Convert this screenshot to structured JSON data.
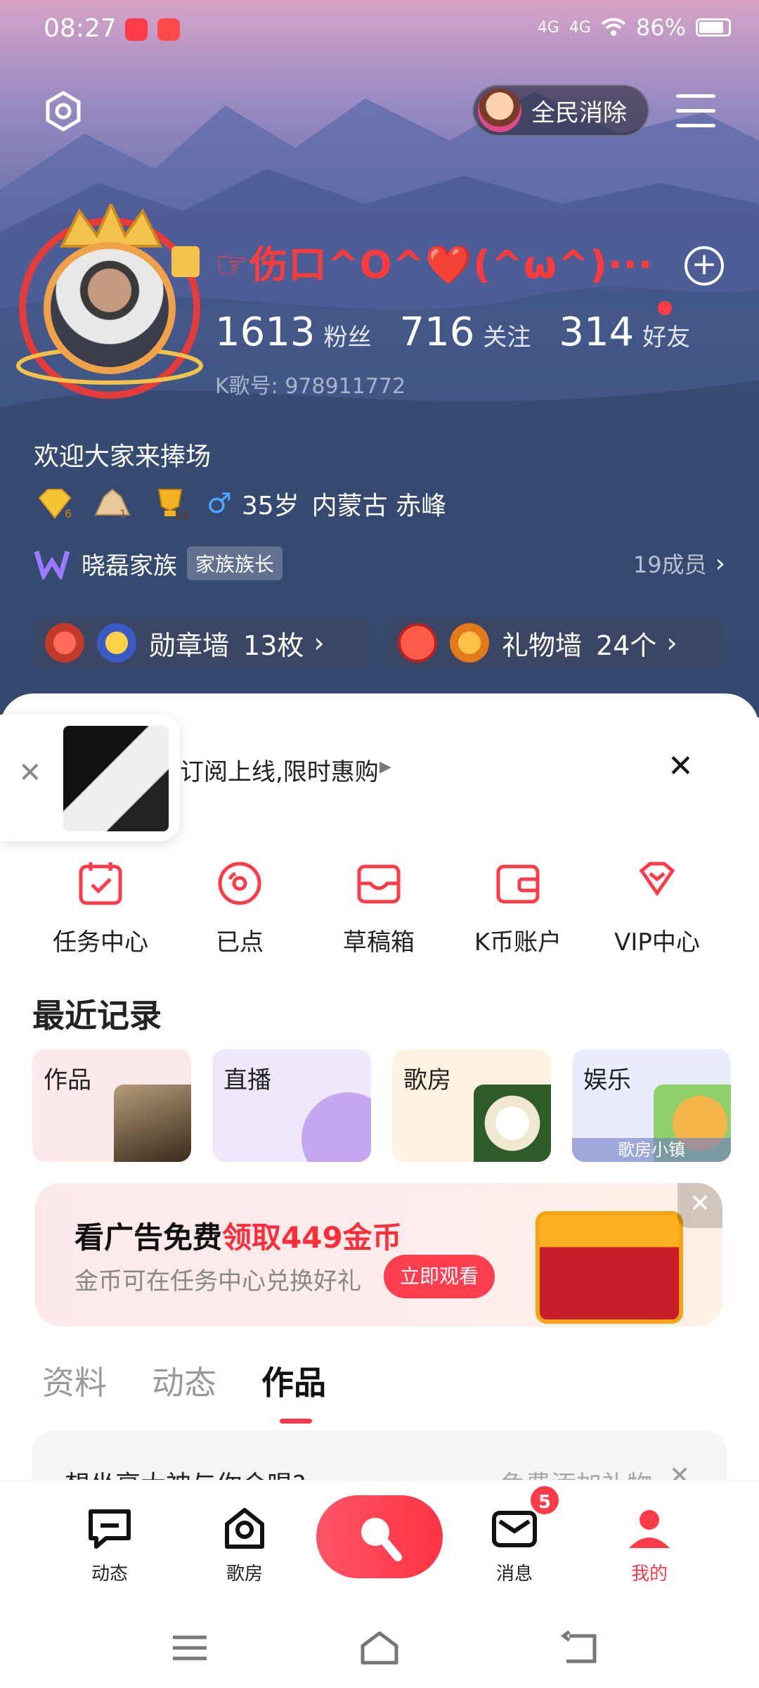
{
  "status_bar": {
    "time": "08:27",
    "network1": "4G",
    "network2": "4G",
    "battery": "86%"
  },
  "header": {
    "game_label": "全民消除"
  },
  "profile": {
    "nickname": "☞伤口^O^❤️(^ω^)···",
    "fans_count": "1613",
    "fans_label": "粉丝",
    "follow_count": "716",
    "follow_label": "关注",
    "friends_count": "314",
    "friends_label": "好友",
    "kid": "K歌号: 978911772",
    "bio": "欢迎大家来捧场",
    "badge_counts": [
      "6",
      "1",
      "14"
    ],
    "gender_icon": "♂",
    "age": "35岁",
    "location": "内蒙古 赤峰",
    "family_name": "晓磊家族",
    "family_tag": "家族族长",
    "family_members": "19成员"
  },
  "walls": [
    {
      "label": "勋章墙",
      "count": "13枚"
    },
    {
      "label": "礼物墙",
      "count": "24个"
    }
  ],
  "promo": {
    "text": "订阅上线,限时惠购"
  },
  "shortcuts": [
    {
      "label": "任务中心",
      "icon": "task-icon"
    },
    {
      "label": "已点",
      "icon": "disc-icon"
    },
    {
      "label": "草稿箱",
      "icon": "drafts-icon"
    },
    {
      "label": "K币账户",
      "icon": "wallet-icon"
    },
    {
      "label": "VIP中心",
      "icon": "diamond-icon"
    }
  ],
  "recent": {
    "title": "最近记录",
    "cards": [
      {
        "label": "作品",
        "bg": "#fde8ea"
      },
      {
        "label": "直播",
        "bg": "#efe8fb"
      },
      {
        "label": "歌房",
        "bg": "#fff3df"
      },
      {
        "label": "娱乐",
        "bg": "#e9ecfb",
        "sub": "歌房小镇"
      }
    ]
  },
  "ad": {
    "headline_prefix": "看广告免费",
    "headline_highlight": "领取449金币",
    "subtitle": "金币可在任务中心兑换好礼",
    "cta": "立即观看",
    "close": "✕"
  },
  "tabs": [
    "资料",
    "动态",
    "作品"
  ],
  "duet": {
    "question": "想坐享大神与你合唱?",
    "action": "免费添加礼物",
    "close": "✕"
  },
  "bottom_nav": [
    {
      "label": "动态"
    },
    {
      "label": "歌房"
    },
    {
      "label": "消息",
      "badge": "5"
    },
    {
      "label": "我的"
    }
  ],
  "colors": {
    "accent": "#ff3b4a",
    "nickname": "#ff3b3b"
  }
}
